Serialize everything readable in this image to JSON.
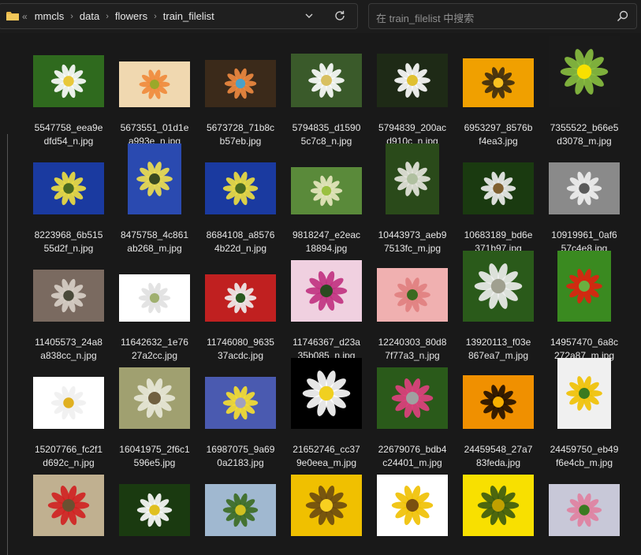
{
  "breadcrumb": {
    "overflow": "«",
    "items": [
      "mmcls",
      "data",
      "flowers",
      "train_filelist"
    ]
  },
  "search": {
    "placeholder": "在 train_filelist 中搜索"
  },
  "colors": {
    "folder": "#e8b84a",
    "background": "#191919",
    "text": "#e6e6e6"
  },
  "files": [
    {
      "name": "5547758_eea9edfd54_n.jpg",
      "line1": "5547758_eea9e",
      "line2": "dfd54_n.jpg",
      "colors": [
        "#2f6a1e",
        "#ffffff",
        "#e8c83a"
      ]
    },
    {
      "name": "5673551_01d1ea993e_n.jpg",
      "line1": "5673551_01d1e",
      "line2": "a993e_n.jpg",
      "colors": [
        "#f0d8b0",
        "#f08a3a",
        "#9aa82a"
      ]
    },
    {
      "name": "5673728_71b8cb57eb.jpg",
      "line1": "5673728_71b8c",
      "line2": "b57eb.jpg",
      "colors": [
        "#3b2a1a",
        "#f08a40",
        "#4aa0c8"
      ]
    },
    {
      "name": "5794835_d15905c7c8_n.jpg",
      "line1": "5794835_d1590",
      "line2": "5c7c8_n.jpg",
      "colors": [
        "#3a5a2a",
        "#ffffff",
        "#d8c060"
      ]
    },
    {
      "name": "5794839_200acd910c_n.jpg",
      "line1": "5794839_200ac",
      "line2": "d910c_n.jpg",
      "colors": [
        "#1e2a16",
        "#ffffff",
        "#e0c030"
      ]
    },
    {
      "name": "6953297_8576bf4ea3.jpg",
      "line1": "6953297_8576b",
      "line2": "f4ea3.jpg",
      "colors": [
        "#f0a000",
        "#3a2a10",
        "#f8c020"
      ]
    },
    {
      "name": "7355522_b66e5d3078_m.jpg",
      "line1": "7355522_b66e5",
      "line2": "d3078_m.jpg",
      "colors": [
        "#1a1a1a",
        "#8ac040",
        "#f8e000"
      ]
    },
    {
      "name": "8223968_6b51555d2f_n.jpg",
      "line1": "8223968_6b515",
      "line2": "55d2f_n.jpg",
      "colors": [
        "#1a3aa0",
        "#f0e040",
        "#4a6a20"
      ]
    },
    {
      "name": "8475758_4c861ab268_m.jpg",
      "line1": "8475758_4c861",
      "line2": "ab268_m.jpg",
      "colors": [
        "#2a4ab0",
        "#f0e050",
        "#3a4a20"
      ]
    },
    {
      "name": "8684108_a85764b22d_n.jpg",
      "line1": "8684108_a8576",
      "line2": "4b22d_n.jpg",
      "colors": [
        "#1a3aa0",
        "#f0e040",
        "#4a6a20"
      ]
    },
    {
      "name": "9818247_e2eac18894.jpg",
      "line1": "9818247_e2eac",
      "line2": "18894.jpg",
      "colors": [
        "#5a8a3a",
        "#e8e8c0",
        "#9ac040"
      ]
    },
    {
      "name": "10443973_aeb97513fc_m.jpg",
      "line1": "10443973_aeb9",
      "line2": "7513fc_m.jpg",
      "colors": [
        "#2a4a1a",
        "#e8e8e0",
        "#b0c0a0"
      ]
    },
    {
      "name": "10683189_bd6e371b97.jpg",
      "line1": "10683189_bd6e",
      "line2": "371b97.jpg",
      "colors": [
        "#1a3a10",
        "#f0f0f0",
        "#806030"
      ]
    },
    {
      "name": "10919961_0af657c4e8.jpg",
      "line1": "10919961_0af6",
      "line2": "57c4e8.jpg",
      "colors": [
        "#8a8a8a",
        "#f0f0f0",
        "#5a5a5a"
      ]
    },
    {
      "name": "11405573_24a8a838cc_n.jpg",
      "line1": "11405573_24a8",
      "line2": "a838cc_n.jpg",
      "colors": [
        "#7a6a60",
        "#d8d0c8",
        "#4a4a3a"
      ]
    },
    {
      "name": "11642632_1e7627a2cc.jpg",
      "line1": "11642632_1e76",
      "line2": "27a2cc.jpg",
      "colors": [
        "#ffffff",
        "#e0e0e0",
        "#a0b070"
      ]
    },
    {
      "name": "11746080_963537acdc.jpg",
      "line1": "11746080_9635",
      "line2": "37acdc.jpg",
      "colors": [
        "#c02020",
        "#f0f0f0",
        "#2a5a20"
      ]
    },
    {
      "name": "11746367_d23a35b085_n.jpg",
      "line1": "11746367_d23a",
      "line2": "35b085_n.jpg",
      "colors": [
        "#f0d0e0",
        "#c03080",
        "#2a4a20"
      ]
    },
    {
      "name": "12240303_80d87f77a3_n.jpg",
      "line1": "12240303_80d8",
      "line2": "7f77a3_n.jpg",
      "colors": [
        "#f0b0b0",
        "#e08080",
        "#3a6a20"
      ]
    },
    {
      "name": "13920113_f03e867ea7_m.jpg",
      "line1": "13920113_f03e",
      "line2": "867ea7_m.jpg",
      "colors": [
        "#2a5a1a",
        "#f0f0f0",
        "#a0a090"
      ]
    },
    {
      "name": "14957470_6a8c272a87_m.jpg",
      "line1": "14957470_6a8c",
      "line2": "272a87_m.jpg",
      "colors": [
        "#3a8a20",
        "#e02010",
        "#6ab040"
      ]
    },
    {
      "name": "15207766_fc2f1d692c_n.jpg",
      "line1": "15207766_fc2f1",
      "line2": "d692c_n.jpg",
      "colors": [
        "#ffffff",
        "#f0f0f0",
        "#e0b020"
      ]
    },
    {
      "name": "16041975_2f6c1596e5.jpg",
      "line1": "16041975_2f6c1",
      "line2": "596e5.jpg",
      "colors": [
        "#a0a070",
        "#e8e8d8",
        "#706040"
      ]
    },
    {
      "name": "16987075_9a690a2183.jpg",
      "line1": "16987075_9a69",
      "line2": "0a2183.jpg",
      "colors": [
        "#4a5ab0",
        "#f8e030",
        "#a0a0c0"
      ]
    },
    {
      "name": "21652746_cc379e0eea_m.jpg",
      "line1": "21652746_cc37",
      "line2": "9e0eea_m.jpg",
      "colors": [
        "#000000",
        "#ffffff",
        "#f0d020"
      ]
    },
    {
      "name": "22679076_bdb4c24401_m.jpg",
      "line1": "22679076_bdb4",
      "line2": "c24401_m.jpg",
      "colors": [
        "#2a5a1a",
        "#e04080",
        "#a0a0a0"
      ]
    },
    {
      "name": "24459548_27a783feda.jpg",
      "line1": "24459548_27a7",
      "line2": "83feda.jpg",
      "colors": [
        "#f09000",
        "#201000",
        "#f8b000"
      ]
    },
    {
      "name": "24459750_eb49f6e4cb_m.jpg",
      "line1": "24459750_eb49",
      "line2": "f6e4cb_m.jpg",
      "colors": [
        "#f0f0f0",
        "#f0c000",
        "#3a7a20"
      ]
    },
    {
      "name": "row5-1",
      "line1": "",
      "line2": "",
      "colors": [
        "#c0b090",
        "#d02020",
        "#6a5030"
      ]
    },
    {
      "name": "row5-2",
      "line1": "",
      "line2": "",
      "colors": [
        "#1a3a10",
        "#ffffff",
        "#e0c020"
      ]
    },
    {
      "name": "row5-3",
      "line1": "",
      "line2": "",
      "colors": [
        "#a0b8d0",
        "#3a6a20",
        "#d0c020"
      ]
    },
    {
      "name": "row5-4",
      "line1": "",
      "line2": "",
      "colors": [
        "#f0c000",
        "#6a4a10",
        "#f8d020"
      ]
    },
    {
      "name": "row5-5",
      "line1": "",
      "line2": "",
      "colors": [
        "#ffffff",
        "#f0c000",
        "#7a5010"
      ]
    },
    {
      "name": "row5-6",
      "line1": "",
      "line2": "",
      "colors": [
        "#f8e000",
        "#3a5a10",
        "#c0a000"
      ]
    },
    {
      "name": "row5-7",
      "line1": "",
      "line2": "",
      "colors": [
        "#c8c8d8",
        "#e080a0",
        "#3a7a20"
      ]
    }
  ]
}
